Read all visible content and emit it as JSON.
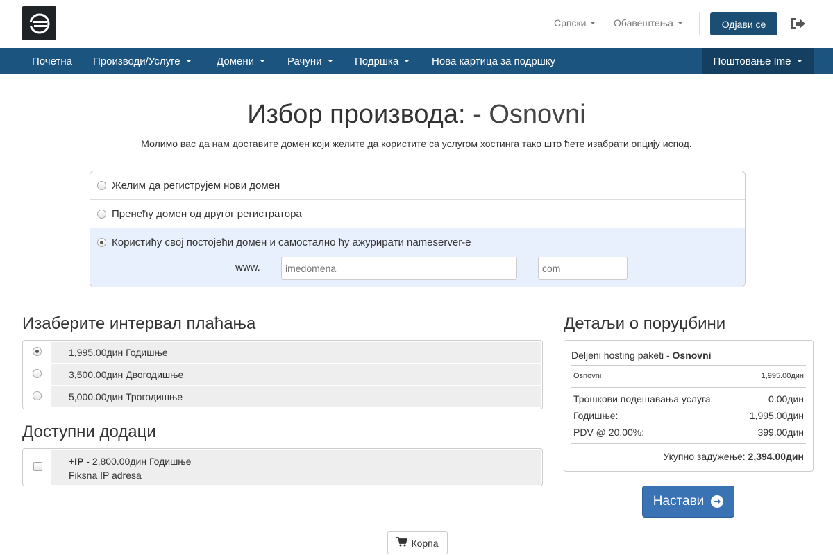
{
  "header": {
    "language_label": "Српски",
    "notifications_label": "Обавештења",
    "logout_label": "Одјави се"
  },
  "nav": {
    "items": [
      {
        "label": "Почетна"
      },
      {
        "label": "Производи/Услуге"
      },
      {
        "label": "Домени"
      },
      {
        "label": "Рачуни"
      },
      {
        "label": "Подршка"
      },
      {
        "label": "Нова картица за подршку"
      }
    ],
    "account_label": "Поштовање Ime"
  },
  "page": {
    "title": "Избор производа:",
    "title_product": "- Osnovni",
    "description": "Молимо вас да нам доставите домен који желите да користите са услугом хостинга тако што ћете изабрати опцију испод."
  },
  "domain": {
    "options": [
      {
        "label": "Желим да региструјем нови домен",
        "selected": false
      },
      {
        "label": "Пренећу домен од другог регистратора",
        "selected": false
      },
      {
        "label": "Користићу свој постојећи домен и самостално ћу ажурирати nameserver-e",
        "selected": true
      }
    ],
    "www_label": "www.",
    "sld_placeholder": "imedomena",
    "tld_placeholder": "com"
  },
  "billing": {
    "heading": "Изаберите интервал плаћања",
    "options": [
      {
        "label": "1,995.00дин Годишње",
        "selected": true
      },
      {
        "label": "3,500.00дин Двогодишње",
        "selected": false
      },
      {
        "label": "5,000.00дин Трогодишње",
        "selected": false
      }
    ]
  },
  "addons": {
    "heading": "Доступни додаци",
    "items": [
      {
        "name": "+IP",
        "price": " - 2,800.00дин Годишње",
        "description": "Fiksna IP adresa",
        "checked": false
      }
    ]
  },
  "summary": {
    "heading": "Детаљи о поруџбини",
    "group": "Deljeni hosting paketi - ",
    "product": "Osnovni",
    "line_item": {
      "label": "Osnovni",
      "value": "1,995.00дин"
    },
    "setup_fee": {
      "label": "Трошкови подешавања услуга:",
      "value": "0.00дин"
    },
    "annual": {
      "label": "Годишње:",
      "value": "1,995.00дин"
    },
    "tax": {
      "label": "PDV @ 20.00%:",
      "value": "399.00дин"
    },
    "total_label": "Укупно задужење: ",
    "total_value": "2,394.00дин"
  },
  "buttons": {
    "continue_label": "Настави",
    "cart_label": "Корпа"
  },
  "colors": {
    "navbar": "#1c5480",
    "navbar_active": "#153f60",
    "primary_button": "#3a73b4",
    "selected_domain_bg": "#e8effd"
  },
  "icons": [
    "company-logo-icon",
    "caret-down-icon",
    "sign-out-icon",
    "arrow-circle-right-icon",
    "shopping-cart-icon"
  ]
}
